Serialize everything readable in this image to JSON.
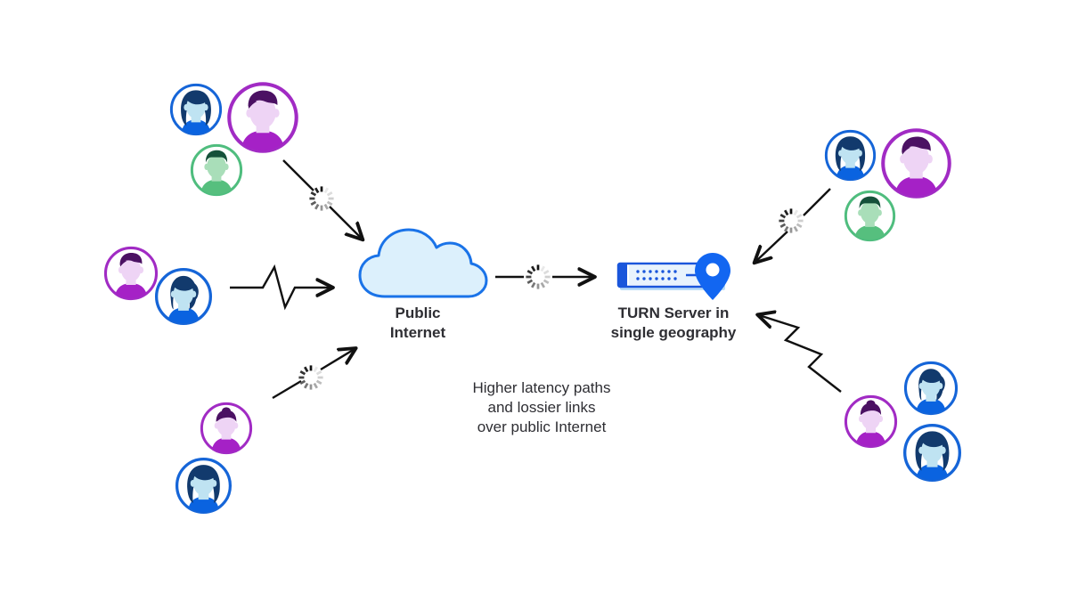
{
  "diagram": {
    "nodes": {
      "cloud": {
        "label": "Public\nInternet",
        "icon": "cloud-icon",
        "fill": "#dcf0fc",
        "stroke": "#1a73e8"
      },
      "turn_server": {
        "label": "TURN Server in\nsingle geography",
        "icon": "server-location-icon",
        "body_fill": "#d6ecfb",
        "accent": "#1a56db",
        "pin_fill": "#1266f1"
      }
    },
    "caption": "Higher latency paths\nand lossier links\nover public Internet",
    "colors": {
      "blue_ring": "#1565d8",
      "blue_hair": "#123a6d",
      "blue_face": "#bfe3f2",
      "blue_shirt": "#0a63e0",
      "purple_ring": "#a12bc4",
      "purple_hair": "#4b1163",
      "purple_face": "#eed4f5",
      "purple_shirt": "#a521c6",
      "green_ring": "#4fbd7e",
      "green_hair": "#15513a",
      "green_face": "#a9deb9",
      "green_shirt": "#56bf7e",
      "line": "#111111",
      "text": "#2e2e33"
    },
    "clusters": [
      {
        "name": "top-left-users",
        "avatars": [
          "female-blue",
          "male-purple",
          "male-green"
        ]
      },
      {
        "name": "mid-left-users",
        "avatars": [
          "male-purple",
          "female-blue-ponytail"
        ]
      },
      {
        "name": "bottom-left-users",
        "avatars": [
          "female-purple-bun",
          "female-blue-long"
        ]
      },
      {
        "name": "top-right-users",
        "avatars": [
          "female-blue",
          "male-purple",
          "male-green"
        ]
      },
      {
        "name": "bottom-right-users",
        "avatars": [
          "female-purple-bun",
          "female-blue-ponytail",
          "female-blue-long"
        ]
      }
    ],
    "connections": [
      {
        "name": "top-left-to-cloud",
        "glyph": "spinner-icon",
        "direction": "down-right"
      },
      {
        "name": "mid-left-to-cloud",
        "glyph": "jitter-icon",
        "direction": "right"
      },
      {
        "name": "bottom-left-to-cloud",
        "glyph": "spinner-icon",
        "direction": "up-right"
      },
      {
        "name": "cloud-to-turn",
        "glyph": "spinner-icon",
        "direction": "right"
      },
      {
        "name": "top-right-to-turn",
        "glyph": "spinner-icon",
        "direction": "down-left"
      },
      {
        "name": "bottom-right-to-turn",
        "glyph": "jitter-icon",
        "direction": "up-left"
      }
    ]
  }
}
